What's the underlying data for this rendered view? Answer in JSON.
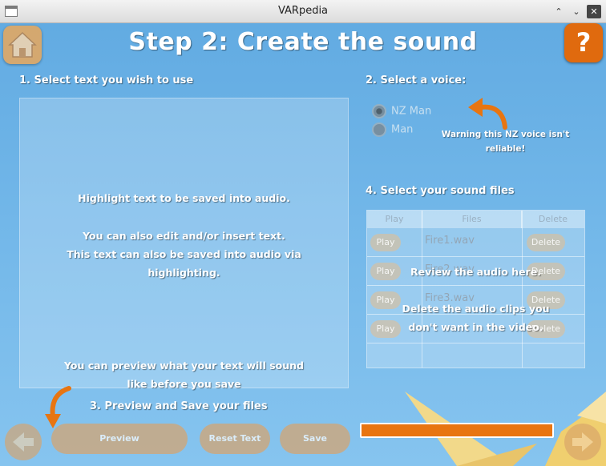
{
  "window": {
    "title": "VARpedia"
  },
  "header": {
    "title": "Step 2: Create the sound",
    "help_label": "?"
  },
  "sections": {
    "select_text": "1. Select text you wish to use",
    "select_voice": "2. Select a voice:",
    "preview_save": "3. Preview and Save your files",
    "sound_files": "4. Select your sound files"
  },
  "text_area": {
    "hint1": "Highlight text to be saved into audio.",
    "hint2": "You can also edit and/or insert text.",
    "hint3": "This text can also be saved into audio via",
    "hint4": "highlighting."
  },
  "preview_hint": {
    "line1": "You can preview what your text will sound",
    "line2": "like before you save"
  },
  "voices": {
    "options": [
      {
        "label": "NZ Man",
        "selected": true
      },
      {
        "label": "Man",
        "selected": false
      }
    ],
    "warning1": "Warning this NZ voice isn't",
    "warning2": "reliable!"
  },
  "files_table": {
    "headers": {
      "play": "Play",
      "files": "Files",
      "delete": "Delete"
    },
    "rows": [
      {
        "play": "Play",
        "file": "Fire1.wav",
        "delete": "Delete"
      },
      {
        "play": "Play",
        "file": "Fire2.wav",
        "delete": "Delete"
      },
      {
        "play": "Play",
        "file": "Fire3.wav",
        "delete": "Delete"
      },
      {
        "play": "Play",
        "file": "",
        "delete": "Delete"
      }
    ],
    "overlay_review": "Review the audio here.",
    "overlay_delete1": "Delete the audio clips you",
    "overlay_delete2": "don't want in the video."
  },
  "buttons": {
    "preview": "Preview",
    "reset_text": "Reset Text",
    "save": "Save"
  },
  "progress": {
    "fraction": 1.0
  },
  "colors": {
    "accent": "#e87511",
    "background": "#6db4e8"
  },
  "icons": {
    "home": "home-icon",
    "back": "back-arrow-icon",
    "next": "next-arrow-icon",
    "pointer": "curved-arrow-icon"
  }
}
